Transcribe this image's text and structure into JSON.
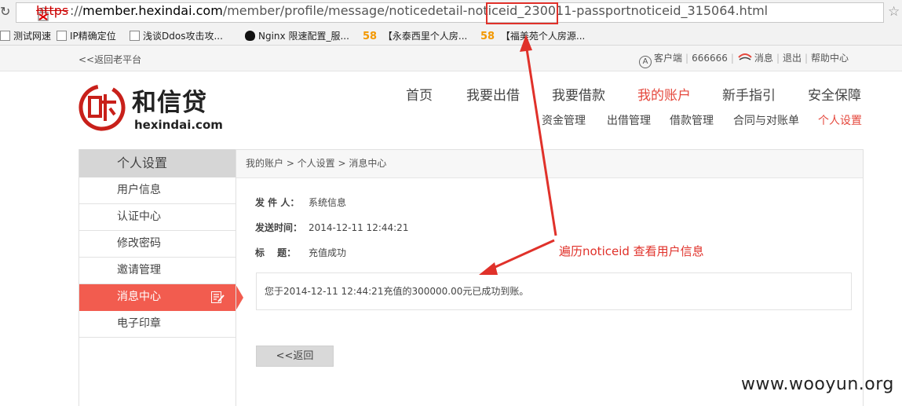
{
  "browser": {
    "url_scheme": "https",
    "url_rest_prefix": "://",
    "url_host": "member.hexindai.com",
    "url_path": "/member/profile/message/noticedetail-noticeid_230011-passportnoticeid_315064.html",
    "bookmarks": [
      {
        "label": "测试网速",
        "icon": "page-icon"
      },
      {
        "label": "IP精确定位",
        "icon": "page-icon"
      },
      {
        "label": "浅谈Ddos攻击攻...",
        "icon": "page-icon"
      },
      {
        "label": "Nginx 限速配置_服...",
        "icon": "penguin-icon"
      },
      {
        "label": "【永泰西里个人房...",
        "icon": "58-icon",
        "icon_text": "58"
      },
      {
        "label": "【福美苑个人房源...",
        "icon": "58-icon",
        "icon_text": "58"
      }
    ]
  },
  "topbar": {
    "back_old": "<<返回老平台",
    "client": "客户端",
    "phone": "666666",
    "messages": "消息",
    "logout": "退出",
    "help": "帮助中心"
  },
  "header": {
    "logo_cn": "和信贷",
    "logo_en": "hexindai.com",
    "main_nav": [
      "首页",
      "我要出借",
      "我要借款",
      "我的账户",
      "新手指引",
      "安全保障"
    ],
    "main_nav_active": 3,
    "sub_nav": [
      "资金管理",
      "出借管理",
      "借款管理",
      "合同与对账单",
      "个人设置"
    ],
    "sub_nav_active": 4
  },
  "sidebar": {
    "title": "个人设置",
    "items": [
      "用户信息",
      "认证中心",
      "修改密码",
      "邀请管理",
      "消息中心",
      "电子印章"
    ],
    "active_index": 4
  },
  "content": {
    "breadcrumb": "我的账户 > 个人设置 > 消息中心",
    "sender_label": "发 件 人：",
    "sender_value": "系统信息",
    "time_label": "发送时间：",
    "time_value": "2014-12-11 12:44:21",
    "subject_label": "标　 题：",
    "subject_value": "充值成功",
    "message": "您于2014-12-11 12:44:21充值的300000.00元已成功到账。",
    "back_button": "<<返回"
  },
  "annotation": {
    "text": "遍历noticeid 查看用户信息",
    "color": "#e0312a"
  },
  "watermark": "www.wooyun.org",
  "colors": {
    "accent": "#e5483d",
    "sidebar_active": "#f25c4f"
  }
}
